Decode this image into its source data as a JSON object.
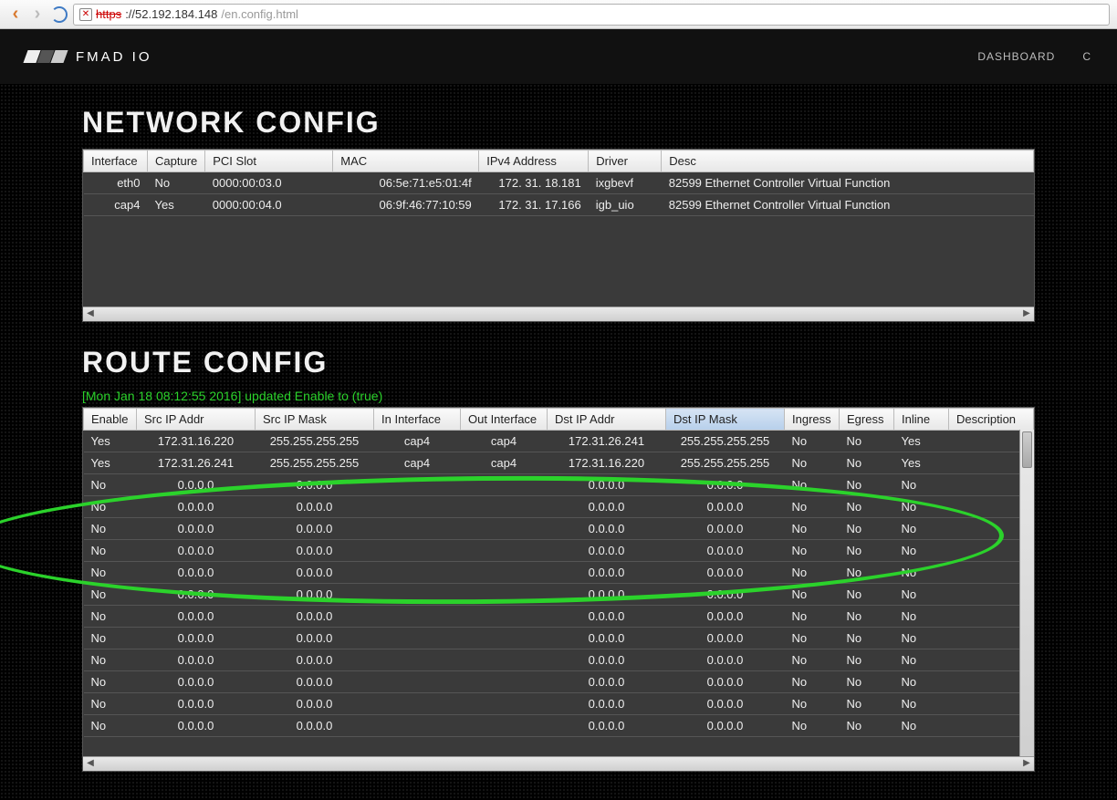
{
  "browser": {
    "url_scheme": "https",
    "url_host": "://52.192.184.148",
    "url_path": "/en.config.html"
  },
  "navbar": {
    "brand": "FMAD IO",
    "links": [
      "DASHBOARD",
      "C"
    ]
  },
  "network": {
    "title": "NETWORK CONFIG",
    "headers": [
      "Interface",
      "Capture",
      "PCI Slot",
      "MAC",
      "IPv4 Address",
      "Driver",
      "Desc"
    ],
    "rows": [
      {
        "iface": "eth0",
        "capture": "No",
        "pci": "0000:00:03.0",
        "mac": "06:5e:71:e5:01:4f",
        "ip": "172. 31. 18.181",
        "driver": "ixgbevf",
        "desc": "82599 Ethernet Controller Virtual Function"
      },
      {
        "iface": "cap4",
        "capture": "Yes",
        "pci": "0000:00:04.0",
        "mac": "06:9f:46:77:10:59",
        "ip": "172. 31. 17.166",
        "driver": "igb_uio",
        "desc": "82599 Ethernet Controller Virtual Function"
      }
    ]
  },
  "route": {
    "title": "ROUTE CONFIG",
    "status": "[Mon Jan 18 08:12:55 2016] updated Enable to (true)",
    "headers": [
      "Enable",
      "Src IP Addr",
      "Src IP Mask",
      "In Interface",
      "Out Interface",
      "Dst IP Addr",
      "Dst IP Mask",
      "Ingress",
      "Egress",
      "Inline",
      "Description"
    ],
    "rows": [
      {
        "enable": "Yes",
        "src": "172.31.16.220",
        "smask": "255.255.255.255",
        "inif": "cap4",
        "outif": "cap4",
        "dst": "172.31.26.241",
        "dmask": "255.255.255.255",
        "ing": "No",
        "eg": "No",
        "inl": "Yes",
        "desc": ""
      },
      {
        "enable": "Yes",
        "src": "172.31.26.241",
        "smask": "255.255.255.255",
        "inif": "cap4",
        "outif": "cap4",
        "dst": "172.31.16.220",
        "dmask": "255.255.255.255",
        "ing": "No",
        "eg": "No",
        "inl": "Yes",
        "desc": ""
      },
      {
        "enable": "No",
        "src": "0.0.0.0",
        "smask": "0.0.0.0",
        "inif": "",
        "outif": "",
        "dst": "0.0.0.0",
        "dmask": "0.0.0.0",
        "ing": "No",
        "eg": "No",
        "inl": "No",
        "desc": ""
      },
      {
        "enable": "No",
        "src": "0.0.0.0",
        "smask": "0.0.0.0",
        "inif": "",
        "outif": "",
        "dst": "0.0.0.0",
        "dmask": "0.0.0.0",
        "ing": "No",
        "eg": "No",
        "inl": "No",
        "desc": ""
      },
      {
        "enable": "No",
        "src": "0.0.0.0",
        "smask": "0.0.0.0",
        "inif": "",
        "outif": "",
        "dst": "0.0.0.0",
        "dmask": "0.0.0.0",
        "ing": "No",
        "eg": "No",
        "inl": "No",
        "desc": ""
      },
      {
        "enable": "No",
        "src": "0.0.0.0",
        "smask": "0.0.0.0",
        "inif": "",
        "outif": "",
        "dst": "0.0.0.0",
        "dmask": "0.0.0.0",
        "ing": "No",
        "eg": "No",
        "inl": "No",
        "desc": ""
      },
      {
        "enable": "No",
        "src": "0.0.0.0",
        "smask": "0.0.0.0",
        "inif": "",
        "outif": "",
        "dst": "0.0.0.0",
        "dmask": "0.0.0.0",
        "ing": "No",
        "eg": "No",
        "inl": "No",
        "desc": ""
      },
      {
        "enable": "No",
        "src": "0.0.0.0",
        "smask": "0.0.0.0",
        "inif": "",
        "outif": "",
        "dst": "0.0.0.0",
        "dmask": "0.0.0.0",
        "ing": "No",
        "eg": "No",
        "inl": "No",
        "desc": ""
      },
      {
        "enable": "No",
        "src": "0.0.0.0",
        "smask": "0.0.0.0",
        "inif": "",
        "outif": "",
        "dst": "0.0.0.0",
        "dmask": "0.0.0.0",
        "ing": "No",
        "eg": "No",
        "inl": "No",
        "desc": ""
      },
      {
        "enable": "No",
        "src": "0.0.0.0",
        "smask": "0.0.0.0",
        "inif": "",
        "outif": "",
        "dst": "0.0.0.0",
        "dmask": "0.0.0.0",
        "ing": "No",
        "eg": "No",
        "inl": "No",
        "desc": ""
      },
      {
        "enable": "No",
        "src": "0.0.0.0",
        "smask": "0.0.0.0",
        "inif": "",
        "outif": "",
        "dst": "0.0.0.0",
        "dmask": "0.0.0.0",
        "ing": "No",
        "eg": "No",
        "inl": "No",
        "desc": ""
      },
      {
        "enable": "No",
        "src": "0.0.0.0",
        "smask": "0.0.0.0",
        "inif": "",
        "outif": "",
        "dst": "0.0.0.0",
        "dmask": "0.0.0.0",
        "ing": "No",
        "eg": "No",
        "inl": "No",
        "desc": ""
      },
      {
        "enable": "No",
        "src": "0.0.0.0",
        "smask": "0.0.0.0",
        "inif": "",
        "outif": "",
        "dst": "0.0.0.0",
        "dmask": "0.0.0.0",
        "ing": "No",
        "eg": "No",
        "inl": "No",
        "desc": ""
      },
      {
        "enable": "No",
        "src": "0.0.0.0",
        "smask": "0.0.0.0",
        "inif": "",
        "outif": "",
        "dst": "0.0.0.0",
        "dmask": "0.0.0.0",
        "ing": "No",
        "eg": "No",
        "inl": "No",
        "desc": ""
      }
    ]
  }
}
